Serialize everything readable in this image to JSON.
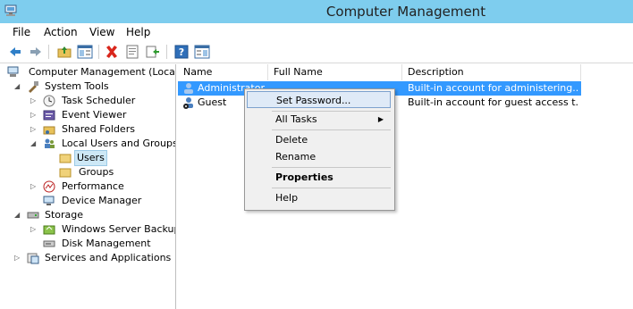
{
  "window": {
    "title": "Computer Management"
  },
  "menu": [
    "File",
    "Action",
    "View",
    "Help"
  ],
  "toolbar": {
    "icons": [
      "back-icon",
      "forward-icon",
      "up-folder-icon",
      "show-hide-tree-icon",
      "delete-icon",
      "properties-icon",
      "export-icon",
      "help-icon",
      "show-hide-action-pane-icon"
    ]
  },
  "tree": {
    "root": "Computer Management (Local",
    "system_tools": "System Tools",
    "task_scheduler": "Task Scheduler",
    "event_viewer": "Event Viewer",
    "shared_folders": "Shared Folders",
    "local_users": "Local Users and Groups",
    "users": "Users",
    "groups": "Groups",
    "performance": "Performance",
    "device_manager": "Device Manager",
    "storage": "Storage",
    "wsb": "Windows Server Backup",
    "disk_mgmt": "Disk Management",
    "services": "Services and Applications"
  },
  "list": {
    "columns": [
      "Name",
      "Full Name",
      "Description"
    ],
    "rows": [
      {
        "name": "Administrator",
        "full_name": "",
        "description": "Built-in account for administering..."
      },
      {
        "name": "Guest",
        "full_name": "",
        "description": "Built-in account for guest access t..."
      }
    ]
  },
  "context_menu": {
    "set_password": "Set Password...",
    "all_tasks": "All Tasks",
    "delete": "Delete",
    "rename": "Rename",
    "properties": "Properties",
    "help": "Help"
  },
  "colors": {
    "titlebar": "#7ecdee",
    "selection": "#3399ff",
    "accent": "#0078d7"
  }
}
